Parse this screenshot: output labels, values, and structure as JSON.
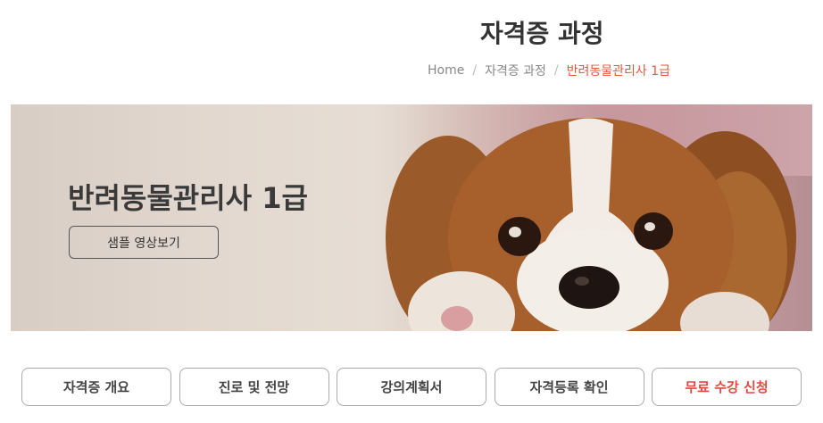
{
  "header": {
    "title": "자격증 과정"
  },
  "breadcrumb": {
    "items": [
      "Home",
      "자격증 과정",
      "반려동물관리사 1급"
    ],
    "separator": "/"
  },
  "banner": {
    "title": "반려동물관리사 1급",
    "sample_button_label": "샘플 영상보기"
  },
  "tabs": [
    {
      "label": "자격증 개요"
    },
    {
      "label": "진로 및 전망"
    },
    {
      "label": "강의계획서"
    },
    {
      "label": "자격등록 확인"
    },
    {
      "label": "무료 수강 신청"
    }
  ],
  "colors": {
    "accent": "#e05a3a",
    "free_trial": "#e8473f",
    "title_text": "#333333"
  }
}
